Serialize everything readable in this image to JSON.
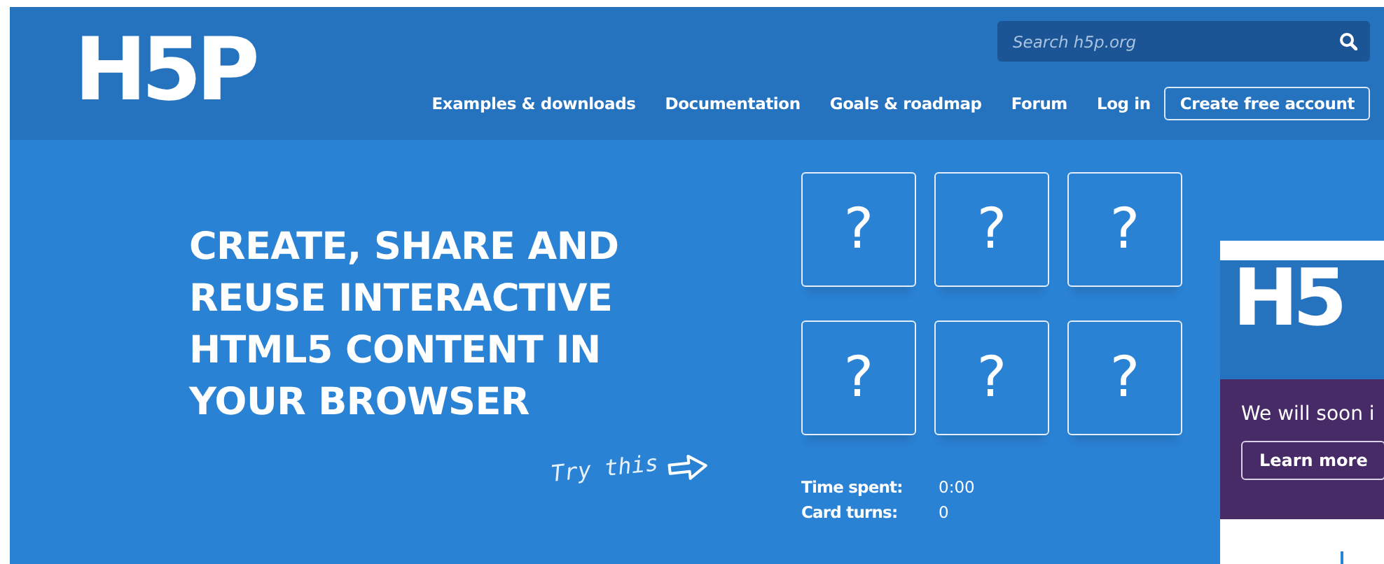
{
  "header": {
    "logo": "H5P",
    "search": {
      "placeholder": "Search h5p.org"
    },
    "nav": [
      {
        "label": "Examples & downloads",
        "kind": "link"
      },
      {
        "label": "Documentation",
        "kind": "link"
      },
      {
        "label": "Goals & roadmap",
        "kind": "link"
      },
      {
        "label": "Forum",
        "kind": "link"
      },
      {
        "label": "Log in",
        "kind": "link"
      },
      {
        "label": "Create free account",
        "kind": "button"
      }
    ]
  },
  "hero": {
    "headline": "CREATE, SHARE AND REUSE INTERACTIVE HTML5 CONTENT IN YOUR BROWSER",
    "try_label": "Try this",
    "cards": [
      "?",
      "?",
      "?",
      "?",
      "?",
      "?"
    ],
    "stats": [
      {
        "label": "Time spent:",
        "value": "0:00"
      },
      {
        "label": "Card turns:",
        "value": "0"
      }
    ]
  },
  "popup": {
    "logo": "H5",
    "message": "We will soon i",
    "button": "Learn more"
  }
}
